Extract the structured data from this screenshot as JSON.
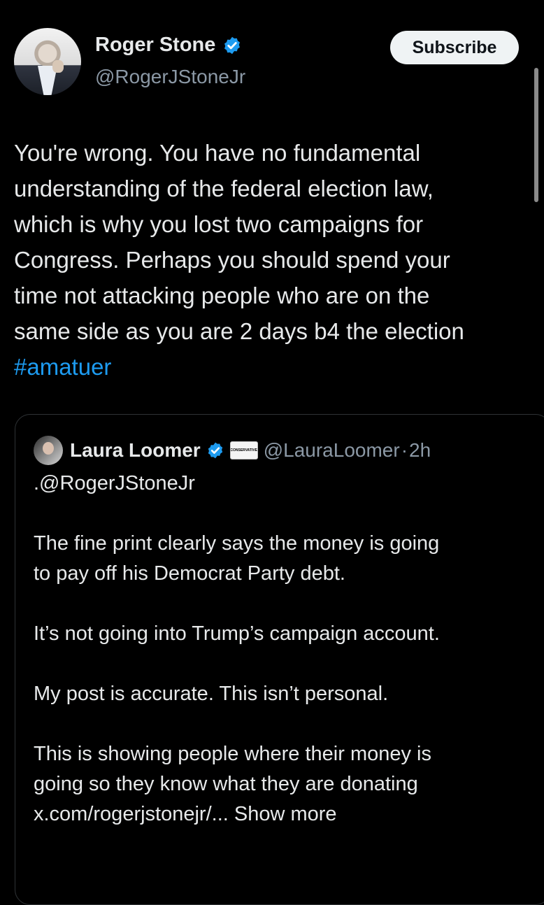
{
  "post": {
    "author": {
      "display_name": "Roger Stone",
      "handle": "@RogerJStoneJr",
      "verified": true
    },
    "subscribe_label": "Subscribe",
    "text_lines": [
      "You're wrong. You have no fundamental",
      "understanding of the federal election law,",
      "which is why you lost two campaigns for",
      "Congress. Perhaps you should spend your",
      "time not attacking people who are on the",
      "same side as you are 2 days b4 the election"
    ],
    "hashtag": "#amatuer"
  },
  "quoted_post": {
    "author": {
      "display_name": "Laura Loomer",
      "handle": "@LauraLoomer",
      "verified": true,
      "affiliation_badge": "CONSERVATIVE"
    },
    "separator": "·",
    "time": "2h",
    "mention_line": ".@RogerJStoneJr",
    "paragraph_1": [
      "The fine print clearly says the money is going",
      "to pay off his Democrat Party debt."
    ],
    "paragraph_2": "It’s not going into Trump’s campaign account.",
    "paragraph_3": "My post is accurate. This isn’t personal.",
    "paragraph_4": [
      "This is showing people where their money is",
      "going so they know what they are donating"
    ],
    "link_text": "x.com/rogerjstonejr/...",
    "show_more": "Show more"
  },
  "colors": {
    "background": "#000000",
    "text": "#e7e9ea",
    "secondary": "#8b98a5",
    "accent": "#1d9bf0",
    "verified": "#1d9bf0",
    "border": "#2f3336",
    "subscribe_bg": "#eff3f4"
  }
}
